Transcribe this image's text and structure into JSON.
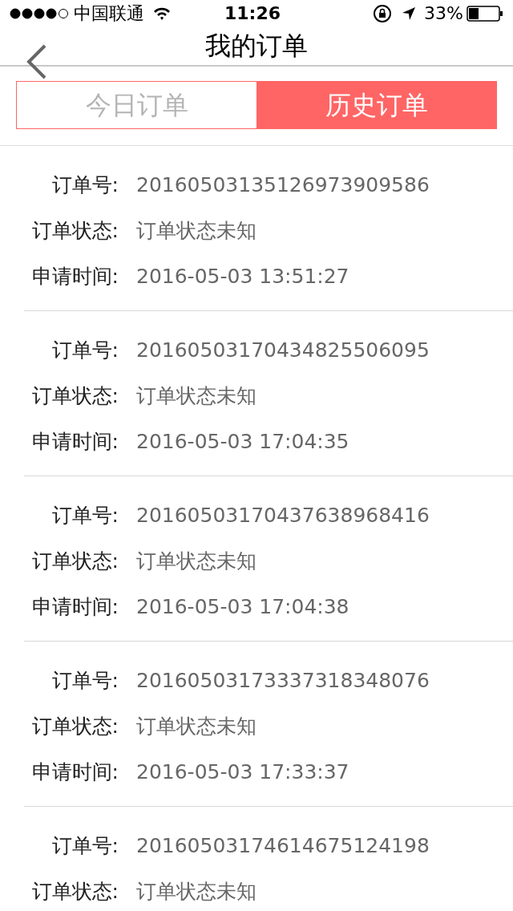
{
  "status_bar": {
    "carrier": "中国联通",
    "time": "11:26",
    "battery": "33%"
  },
  "nav_bar": {
    "title": "我的订单"
  },
  "tabs": [
    {
      "label": "今日订单",
      "selected": false
    },
    {
      "label": "历史订单",
      "selected": true
    }
  ],
  "orders": [
    {
      "fields": [
        {
          "label": "订单号:",
          "value": "20160503135126973909586"
        },
        {
          "label": "订单状态:",
          "value": "订单状态未知"
        },
        {
          "label": "申请时间:",
          "value": "2016-05-03 13:51:27"
        }
      ]
    },
    {
      "fields": [
        {
          "label": "订单号:",
          "value": "20160503170434825506095"
        },
        {
          "label": "订单状态:",
          "value": "订单状态未知"
        },
        {
          "label": "申请时间:",
          "value": "2016-05-03 17:04:35"
        }
      ]
    },
    {
      "fields": [
        {
          "label": "订单号:",
          "value": "20160503170437638968416"
        },
        {
          "label": "订单状态:",
          "value": "订单状态未知"
        },
        {
          "label": "申请时间:",
          "value": "2016-05-03 17:04:38"
        }
      ]
    },
    {
      "fields": [
        {
          "label": "订单号:",
          "value": "20160503173337318348076"
        },
        {
          "label": "订单状态:",
          "value": "订单状态未知"
        },
        {
          "label": "申请时间:",
          "value": "2016-05-03 17:33:37"
        }
      ]
    },
    {
      "fields": [
        {
          "label": "订单号:",
          "value": "20160503174614675124198"
        },
        {
          "label": "订单状态:",
          "value": "订单状态未知"
        }
      ]
    }
  ]
}
